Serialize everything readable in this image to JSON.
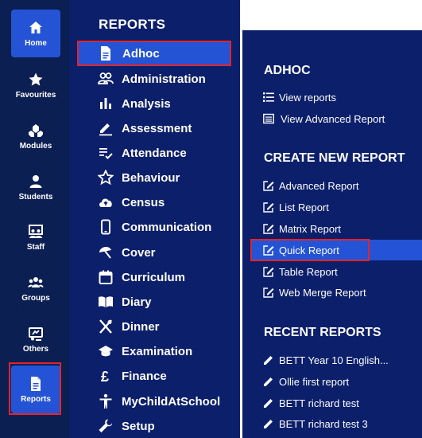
{
  "rail": {
    "items": [
      {
        "label": "Home",
        "icon": "home-icon"
      },
      {
        "label": "Favourites",
        "icon": "star-icon"
      },
      {
        "label": "Modules",
        "icon": "modules-icon"
      },
      {
        "label": "Students",
        "icon": "person-icon"
      },
      {
        "label": "Staff",
        "icon": "staff-icon"
      },
      {
        "label": "Groups",
        "icon": "groups-icon"
      },
      {
        "label": "Others",
        "icon": "others-icon"
      },
      {
        "label": "Reports",
        "icon": "document-icon"
      }
    ]
  },
  "menu": {
    "title": "REPORTS",
    "items": [
      {
        "label": "Adhoc",
        "icon": "document-icon"
      },
      {
        "label": "Administration",
        "icon": "people-icon"
      },
      {
        "label": "Analysis",
        "icon": "bar-chart-icon"
      },
      {
        "label": "Assessment",
        "icon": "pencil-line-icon"
      },
      {
        "label": "Attendance",
        "icon": "checklist-icon"
      },
      {
        "label": "Behaviour",
        "icon": "star-outline-icon"
      },
      {
        "label": "Census",
        "icon": "cloud-upload-icon"
      },
      {
        "label": "Communication",
        "icon": "phone-icon"
      },
      {
        "label": "Cover",
        "icon": "umbrella-icon"
      },
      {
        "label": "Curriculum",
        "icon": "calendar-icon"
      },
      {
        "label": "Diary",
        "icon": "book-icon"
      },
      {
        "label": "Dinner",
        "icon": "cutlery-icon"
      },
      {
        "label": "Examination",
        "icon": "graduation-cap-icon"
      },
      {
        "label": "Finance",
        "icon": "pound-icon"
      },
      {
        "label": "MyChildAtSchool",
        "icon": "accessibility-icon"
      },
      {
        "label": "Setup",
        "icon": "wrench-icon"
      }
    ]
  },
  "submenu": {
    "adhoc": {
      "heading": "ADHOC",
      "items": [
        {
          "label": "View reports",
          "icon": "list-icon"
        },
        {
          "label": "View Advanced Report",
          "icon": "table-list-icon"
        }
      ]
    },
    "create": {
      "heading": "CREATE NEW REPORT",
      "items": [
        {
          "label": "Advanced Report",
          "icon": "edit-icon"
        },
        {
          "label": "List Report",
          "icon": "edit-icon"
        },
        {
          "label": "Matrix Report",
          "icon": "edit-icon"
        },
        {
          "label": "Quick Report",
          "icon": "edit-icon"
        },
        {
          "label": "Table Report",
          "icon": "edit-icon"
        },
        {
          "label": "Web Merge Report",
          "icon": "edit-icon"
        }
      ]
    },
    "recent": {
      "heading": "RECENT REPORTS",
      "items": [
        {
          "label": "BETT Year 10 English...",
          "icon": "pencil-icon"
        },
        {
          "label": "Ollie first report",
          "icon": "pencil-icon"
        },
        {
          "label": "BETT richard test",
          "icon": "pencil-icon"
        },
        {
          "label": "BETT richard test 3",
          "icon": "pencil-icon"
        }
      ]
    }
  },
  "colors": {
    "rail_bg": "#0c1f53",
    "panel_bg": "#0c1f6b",
    "active_bg": "#2453d6",
    "highlight": "#e0252b"
  }
}
